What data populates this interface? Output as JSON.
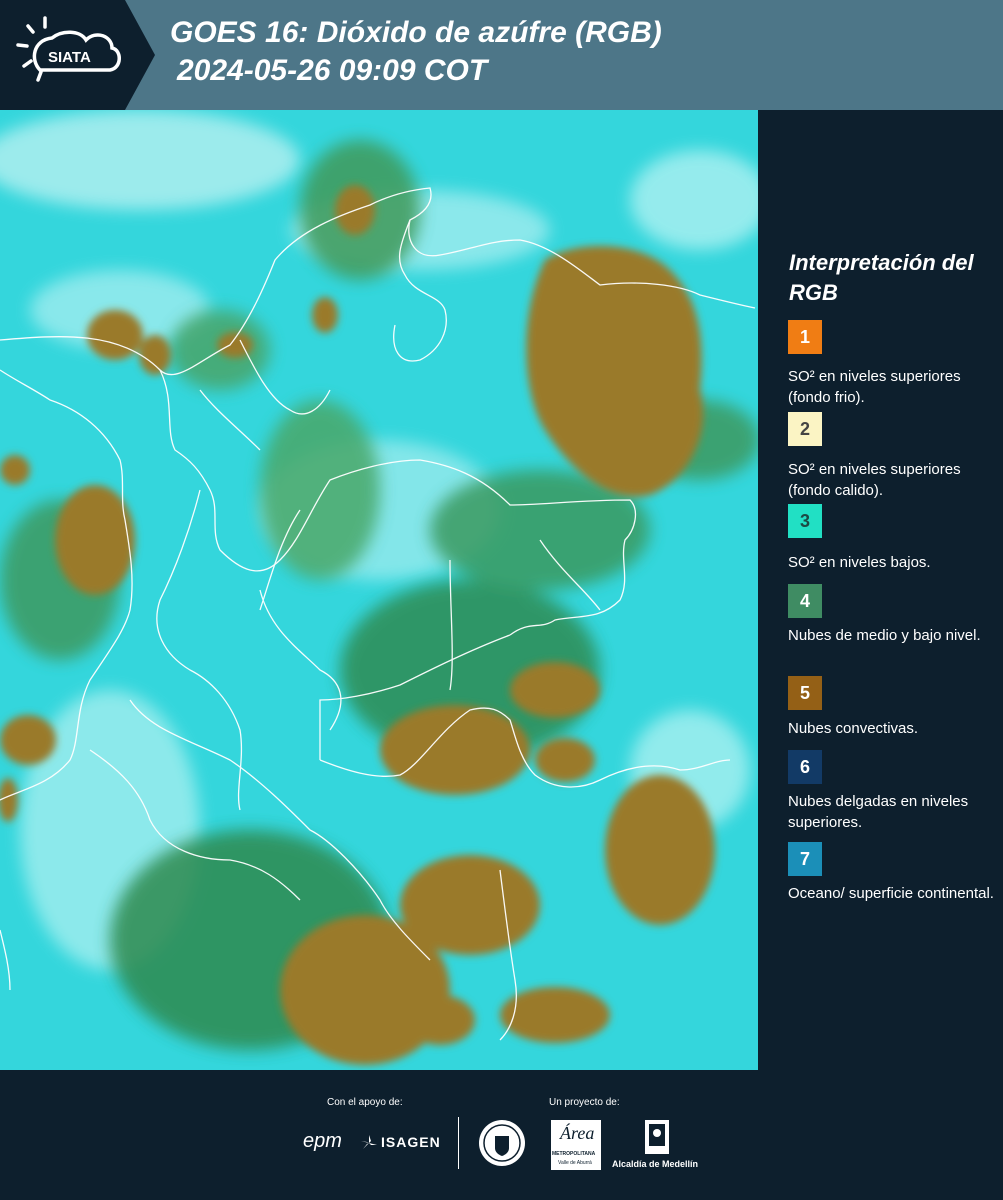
{
  "header": {
    "title_line1": "GOES 16: Dióxido de azúfre (RGB)",
    "title_line2": "2024-05-26 09:09 COT",
    "logo_text": "SIATA",
    "bg_color": "#4d7688"
  },
  "map": {
    "icon": "satellite-rgb-map",
    "colors": {
      "ocean": "#2cd8dc",
      "convective": "#9a7a2c",
      "mid_low": "#3a8a55"
    }
  },
  "legend": {
    "title": "Interpretación del RGB",
    "items": [
      {
        "number": "1",
        "color": "#f07d14",
        "text_color": "#ffffff",
        "label": "SO² en niveles superiores (fondo frio)."
      },
      {
        "number": "2",
        "color": "#fbf4c4",
        "text_color": "#444444",
        "label": "SO² en niveles superiores (fondo calido)."
      },
      {
        "number": "3",
        "color": "#21e0c4",
        "text_color": "#1c4a44",
        "label": "SO² en niveles bajos."
      },
      {
        "number": "4",
        "color": "#3f8c63",
        "text_color": "#ffffff",
        "label": "Nubes de medio y bajo nivel."
      },
      {
        "number": "5",
        "color": "#946016",
        "text_color": "#ffffff",
        "label": "Nubes convectivas."
      },
      {
        "number": "6",
        "color": "#123a66",
        "text_color": "#ffffff",
        "label": "Nubes delgadas en niveles superiores."
      },
      {
        "number": "7",
        "color": "#1b8fb8",
        "text_color": "#ffffff",
        "label": "Oceano/ superficie continental."
      }
    ]
  },
  "footer": {
    "support_label": "Con el apoyo de:",
    "project_label": "Un proyecto de:",
    "sponsor_epm": "epm",
    "sponsor_isagen": "ISAGEN",
    "partner_area_1": "Área",
    "partner_area_2": "METROPOLITANA",
    "partner_area_3": "Valle de Aburrá",
    "partner_alcaldia": "Alcaldía de Medellín"
  }
}
